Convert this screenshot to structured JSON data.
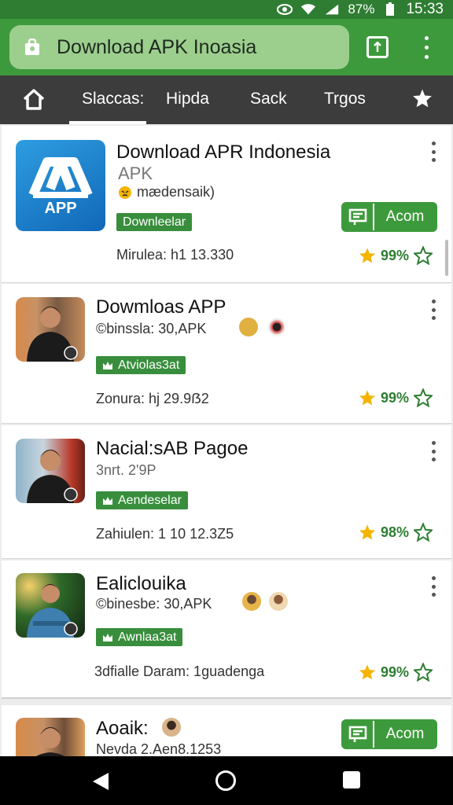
{
  "status": {
    "battery": "87%",
    "time": "15:33"
  },
  "browser": {
    "url": "Download APK Inoasia",
    "tab_count": ""
  },
  "nav": {
    "tabs": [
      "Slaccas:",
      "Hipda",
      "Sack",
      "Trgos"
    ]
  },
  "cards": [
    {
      "title": "Download APR Indonesia",
      "subtitle": "APK",
      "author": "mædensaik)",
      "badge": "Downleelar",
      "meta": "Mirulea: h1 13.330",
      "rating": "99%",
      "button": "Acom",
      "logo_text": "APP"
    },
    {
      "title": "Dowmloas APP",
      "subtitle": "©binssla: 30,APK",
      "badge": "Atviolas3at",
      "meta": "Zonura: hj 29.9ẞ2",
      "rating": "99%"
    },
    {
      "title": "Nacial:sAB Pagoe",
      "subtitle": "3nrt. 2'9P",
      "badge": "Aendeselar",
      "meta": "Zahiulen: 1 10 12.3Z5",
      "rating": "98%"
    },
    {
      "title": "Ealiclouika",
      "subtitle": "©binesbe: 30,APK",
      "badge": "Awnlaa3at",
      "meta": "3dfialle Daram: 1guadenga",
      "rating": "99%"
    },
    {
      "title": "Aoaik:",
      "subtitle": "Nevda 2.Aen8.1253",
      "button": "Acom"
    }
  ],
  "colors": {
    "primary": "#3d9a3c",
    "dark_bar": "#3c3c3c",
    "star": "#f4b400"
  }
}
